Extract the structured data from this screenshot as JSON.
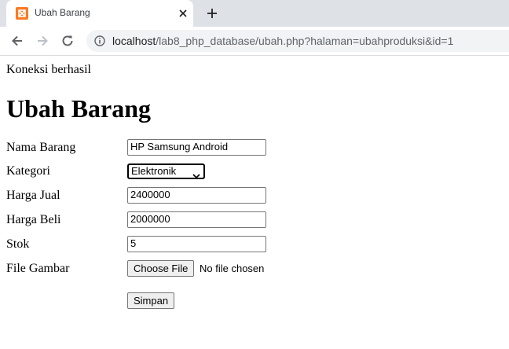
{
  "browser": {
    "tab_title": "Ubah Barang",
    "url_host": "localhost",
    "url_path": "/lab8_php_database/ubah.php?halaman=ubahproduksi&id=1",
    "favicon": "xampp-icon"
  },
  "page": {
    "status": "Koneksi berhasil",
    "heading": "Ubah Barang"
  },
  "form": {
    "nama_label": "Nama Barang",
    "nama_value": "HP Samsung Android",
    "kategori_label": "Kategori",
    "kategori_value": "Elektronik",
    "harga_jual_label": "Harga Jual",
    "harga_jual_value": "2400000",
    "harga_beli_label": "Harga Beli",
    "harga_beli_value": "2000000",
    "stok_label": "Stok",
    "stok_value": "5",
    "gambar_label": "File Gambar",
    "choose_file_label": "Choose File",
    "no_file_text": "No file chosen",
    "submit_label": "Simpan"
  }
}
